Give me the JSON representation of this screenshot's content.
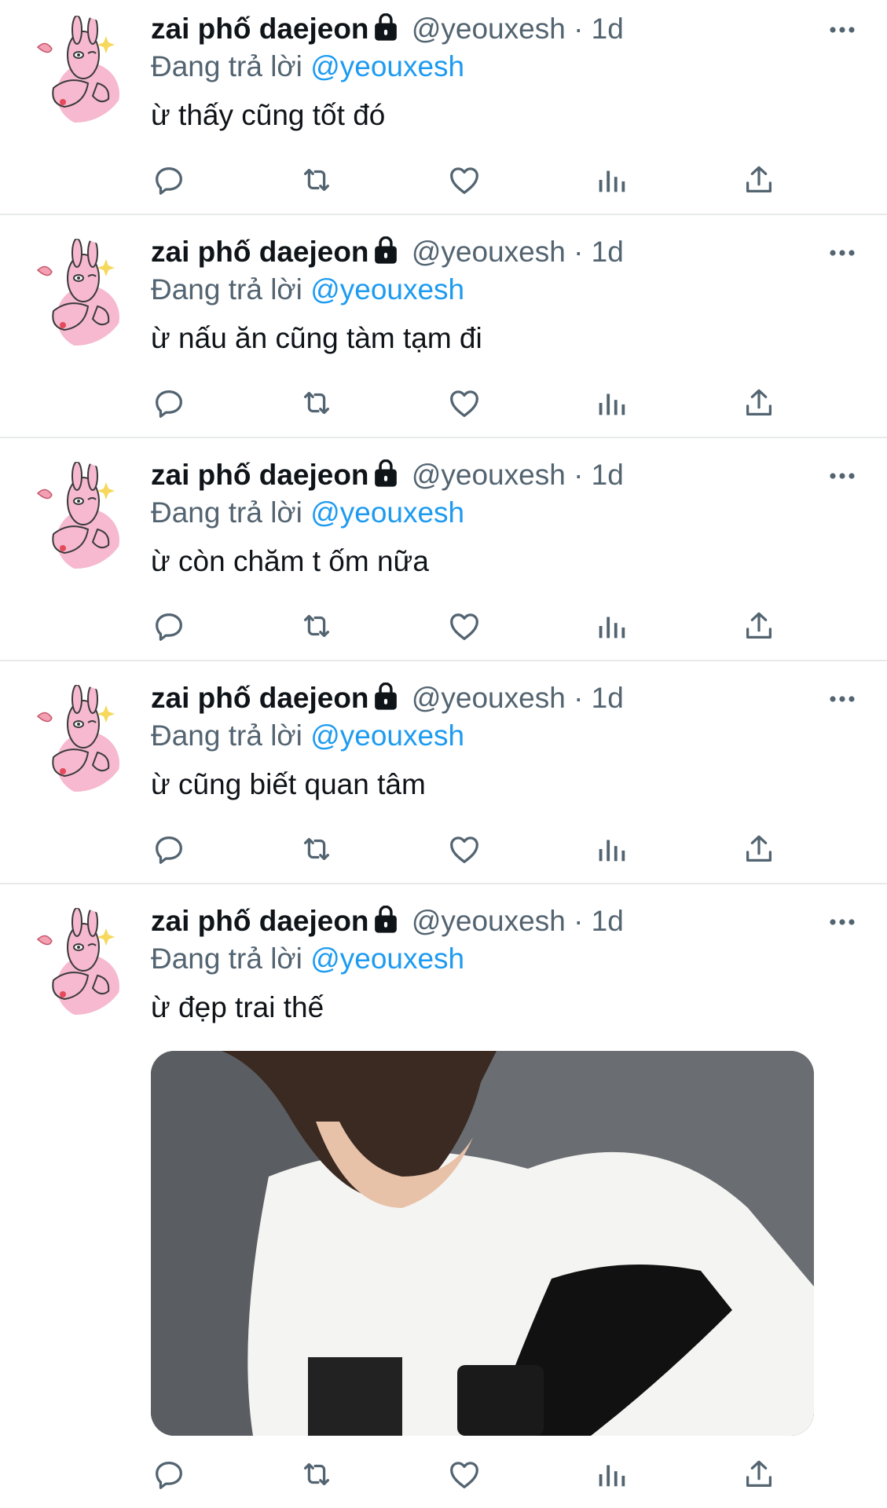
{
  "tweets": [
    {
      "name": "zai phố daejeon",
      "handle": "@yeouxesh",
      "dot": "·",
      "time": "1d",
      "reply_prefix": "Đang trả lời",
      "reply_to": "@yeouxesh",
      "text": "ừ thấy cũng tốt đó"
    },
    {
      "name": "zai phố daejeon",
      "handle": "@yeouxesh",
      "dot": "·",
      "time": "1d",
      "reply_prefix": "Đang trả lời",
      "reply_to": "@yeouxesh",
      "text": "ừ nấu ăn cũng tàm tạm đi"
    },
    {
      "name": "zai phố daejeon",
      "handle": "@yeouxesh",
      "dot": "·",
      "time": "1d",
      "reply_prefix": "Đang trả lời",
      "reply_to": "@yeouxesh",
      "text": "ừ còn chăm t ốm nữa"
    },
    {
      "name": "zai phố daejeon",
      "handle": "@yeouxesh",
      "dot": "·",
      "time": "1d",
      "reply_prefix": "Đang trả lời",
      "reply_to": "@yeouxesh",
      "text": "ừ cũng biết quan tâm"
    },
    {
      "name": "zai phố daejeon",
      "handle": "@yeouxesh",
      "dot": "·",
      "time": "1d",
      "reply_prefix": "Đang trả lời",
      "reply_to": "@yeouxesh",
      "text": "ừ đẹp trai thế"
    }
  ],
  "icons": {
    "avatar": "pink-bunny-sticker-avatar",
    "lock": "lock-icon",
    "more": "more-options-icon",
    "reply": "reply-icon",
    "retweet": "retweet-icon",
    "like": "like-icon",
    "analytics": "analytics-icon",
    "share": "share-icon",
    "media": "photo-of-person-in-white-tshirt"
  },
  "colors": {
    "text": "#0f1419",
    "secondary": "#536471",
    "mention": "#1d9bf0",
    "divider": "#e7e9ea",
    "avatar_pink": "#f6b9cf",
    "background": "#ffffff"
  }
}
